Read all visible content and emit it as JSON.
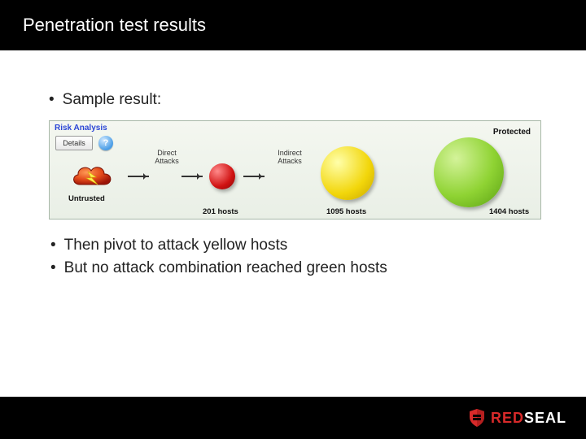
{
  "slide": {
    "title": "Penetration test results"
  },
  "bullets": {
    "top": "Sample result:",
    "sub1": "Then pivot to attack yellow hosts",
    "sub2": "But no attack combination reached green hosts"
  },
  "panel": {
    "title": "Risk Analysis",
    "details_button": "Details",
    "help_glyph": "?",
    "untrusted_label": "Untrusted",
    "direct_label_l1": "Direct",
    "direct_label_l2": "Attacks",
    "indirect_label_l1": "Indirect",
    "indirect_label_l2": "Attacks",
    "protected_label": "Protected",
    "red_hosts": "201 hosts",
    "yellow_hosts": "1095 hosts",
    "green_hosts": "1404 hosts"
  },
  "logo": {
    "name_part1": "RED",
    "name_part2": "SEAL"
  },
  "chart_data": {
    "type": "bar",
    "title": "Risk Analysis host exposure",
    "categories": [
      "Direct Attacks (red)",
      "Indirect Attacks (yellow)",
      "Protected (green)"
    ],
    "values": [
      201,
      1095,
      1404
    ],
    "xlabel": "",
    "ylabel": "hosts",
    "ylim": [
      0,
      1500
    ]
  }
}
